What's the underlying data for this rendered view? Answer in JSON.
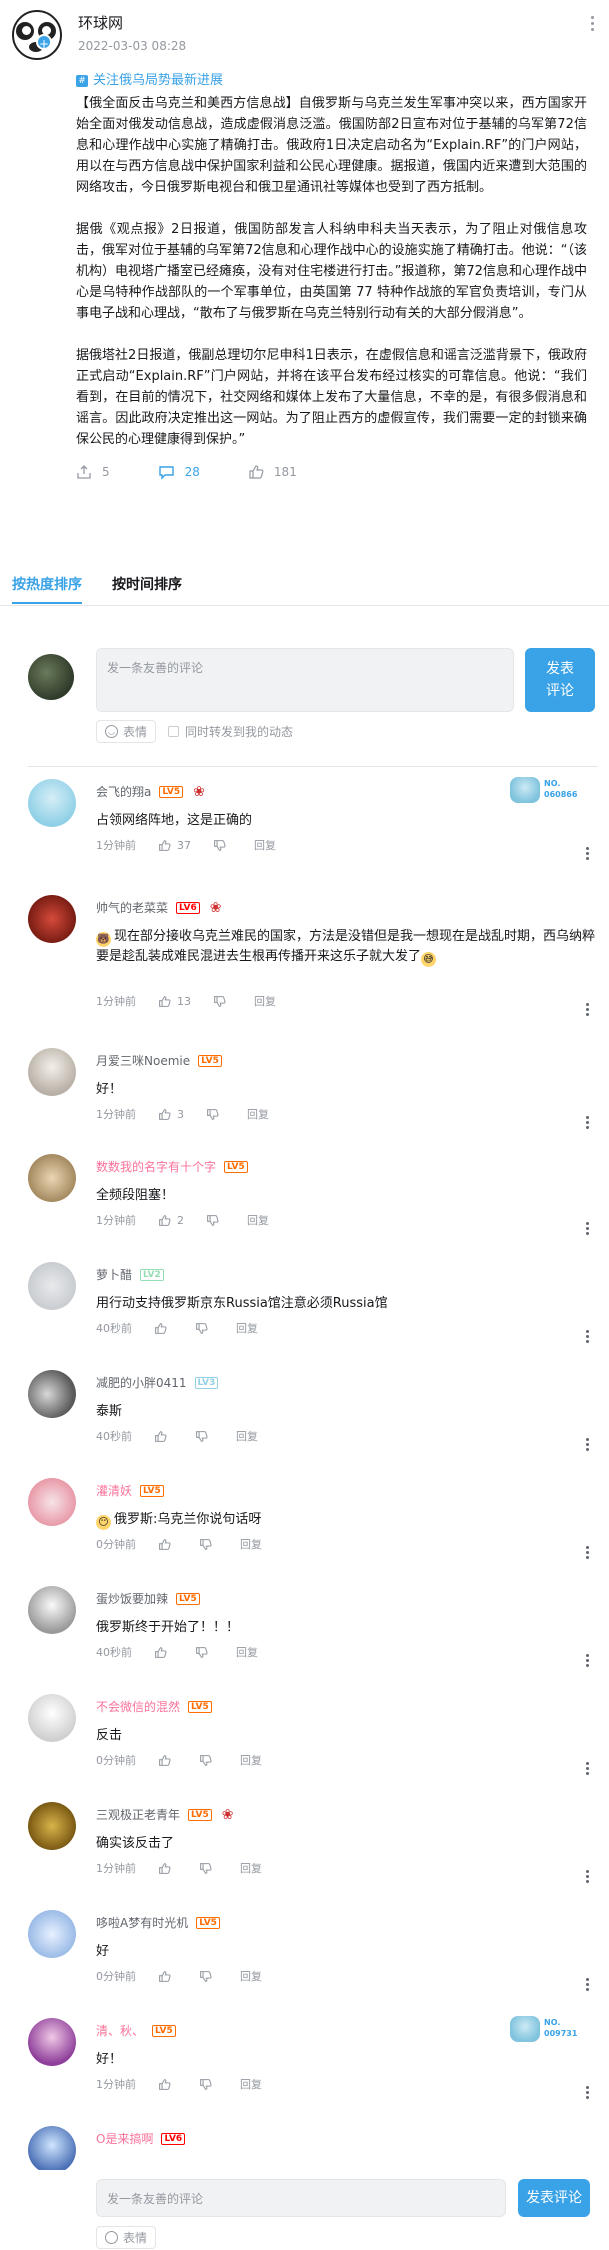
{
  "post": {
    "author": "环球网",
    "time": "2022-03-03 08:28",
    "topic": "关注俄乌局势最新进展",
    "paragraphs": [
      "【俄全面反击乌克兰和美西方信息战】自俄罗斯与乌克兰发生军事冲突以来，西方国家开始全面对俄发动信息战，造成虚假消息泛滥。俄国防部2日宣布对位于基辅的乌军第72信息和心理作战中心实施了精确打击。俄政府1日决定启动名为“Explain.RF”的门户网站，用以在与西方信息战中保护国家利益和公民心理健康。据报道，俄国内近来遭到大范围的网络攻击，今日俄罗斯电视台和俄卫星通讯社等媒体也受到了西方抵制。",
      "据俄《观点报》2日报道，俄国防部发言人科纳申科夫当天表示，为了阻止对俄信息攻击，俄军对位于基辅的乌军第72信息和心理作战中心的设施实施了精确打击。他说：“（该机构）电视塔广播室已经瘫痪，没有对住宅楼进行打击。”报道称，第72信息和心理作战中心是乌特种作战部队的一个军事单位，由英国第 77 特种作战旅的军官负责培训，专门从事电子战和心理战，“散布了与俄罗斯在乌克兰特别行动有关的大部分假消息”。",
      "据俄塔社2日报道，俄副总理切尔尼申科1日表示，在虚假信息和谣言泛滥背景下，俄政府正式启动“Explain.RF”门户网站，并将在该平台发布经过核实的可靠信息。他说：“我们看到，在目前的情况下，社交网络和媒体上发布了大量信息，不幸的是，有很多假消息和谣言。因此政府决定推出这一网站。为了阻止西方的虚假宣传，我们需要一定的封锁来确保公民的心理健康得到保护。”"
    ],
    "shares": "5",
    "comments": "28",
    "likes": "181"
  },
  "tabs": [
    "按热度排序",
    "按时间排序"
  ],
  "composer": {
    "placeholder": "发一条友善的评论",
    "submit": "发表\n评论",
    "emoji": "表情",
    "sync": "同时转发到我的动态"
  },
  "comments": [
    {
      "user": "会飞的翔a",
      "level": "LV5",
      "text": "占领网络阵地，这是正确的",
      "time": "1分钟前",
      "likes": "37",
      "reply": "回复",
      "badge": [
        "NO.",
        "060866"
      ]
    },
    {
      "user": "帅气的老菜菜",
      "level": "LV6",
      "text": "现在部分接收乌克兰难民的国家，方法是没错但是我一想现在是战乱时期，西乌纳粹要是趁乱装成难民混进去生根再传播开来这乐子就大发了",
      "time": "1分钟前",
      "likes": "13",
      "reply": "回复"
    },
    {
      "user": "月爱三咪Noemie",
      "level": "LV5",
      "text": "好！",
      "time": "1分钟前",
      "likes": "3",
      "reply": "回复"
    },
    {
      "user": "数数我的名字有十个字",
      "level": "LV5",
      "text": "全频段阻塞！",
      "time": "1分钟前",
      "likes": "2",
      "reply": "回复"
    },
    {
      "user": "萝卜醋",
      "level": "LV2",
      "text": "用行动支持俄罗斯京东Russia馆注意必须Russia馆",
      "time": "40秒前",
      "likes": "",
      "reply": "回复"
    },
    {
      "user": "减肥的小胖0411",
      "level": "LV3",
      "text": "泰斯",
      "time": "40秒前",
      "likes": "",
      "reply": "回复"
    },
    {
      "user": "灌清妖",
      "level": "LV5",
      "text": "俄罗斯:乌克兰你说句话呀",
      "time": "0分钟前",
      "likes": "",
      "reply": "回复"
    },
    {
      "user": "蛋炒饭要加辣",
      "level": "LV5",
      "text": "俄罗斯终于开始了！！！",
      "time": "40秒前",
      "likes": "",
      "reply": "回复"
    },
    {
      "user": "不会微信的混然",
      "level": "LV5",
      "text": "反击",
      "time": "0分钟前",
      "likes": "",
      "reply": "回复"
    },
    {
      "user": "三观极正老青年",
      "level": "LV5",
      "text": "确实该反击了",
      "time": "1分钟前",
      "likes": "",
      "reply": "回复"
    },
    {
      "user": "哆啦A梦有时光机",
      "level": "LV5",
      "text": "好",
      "time": "0分钟前",
      "likes": "",
      "reply": "回复"
    },
    {
      "user": "清、秋、",
      "level": "LV5",
      "text": "好！",
      "time": "1分钟前",
      "likes": "",
      "reply": "回复",
      "badge": [
        "NO.",
        "009731"
      ]
    },
    {
      "user": "O是来搞啊",
      "level": "LV6",
      "text": "",
      "time": "",
      "likes": "",
      "reply": ""
    }
  ],
  "bottom": {
    "placeholder": "发一条友善的评论",
    "submit": "发表评论",
    "emoji": "表情"
  },
  "colors": {
    "accent": "#3aa2e6",
    "pink": "#fb7299",
    "lv5": "#ff6c00",
    "lv6": "#ff0000",
    "lv2": "#95ddb2",
    "lv3": "#92d1e5"
  }
}
